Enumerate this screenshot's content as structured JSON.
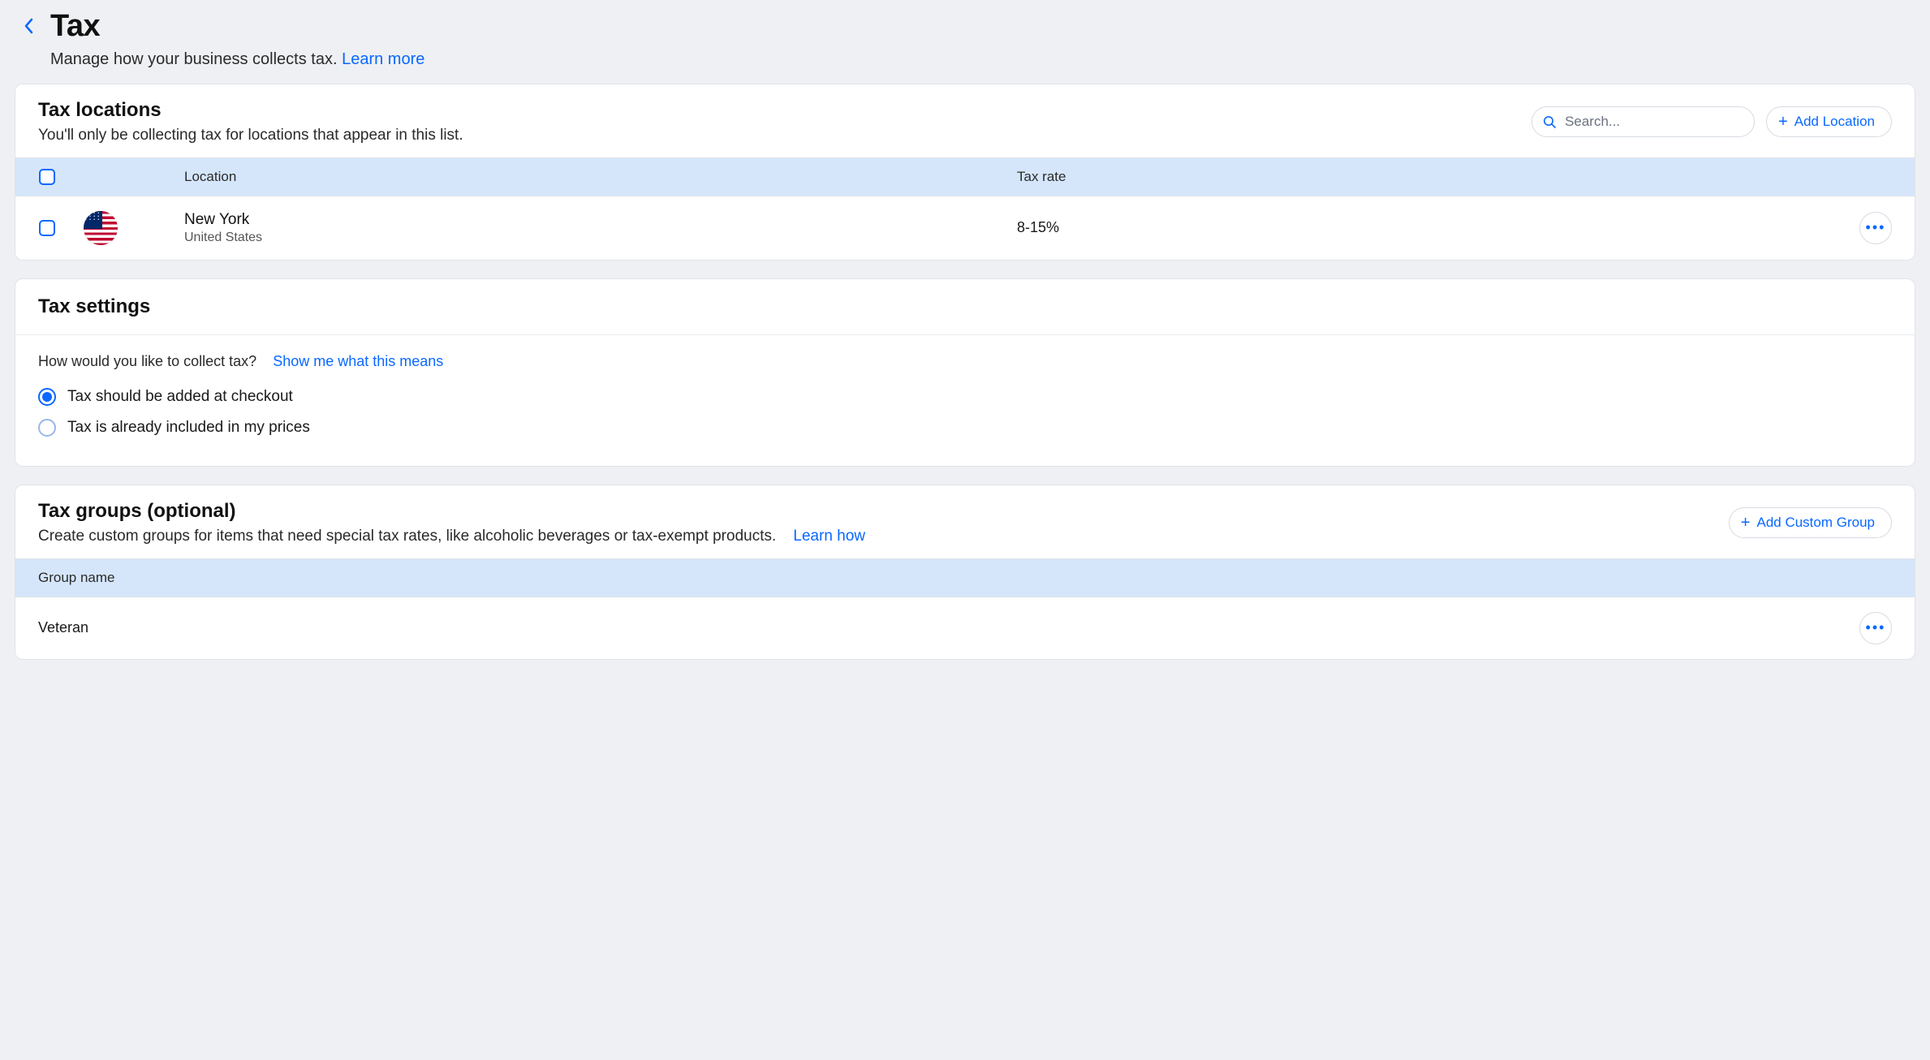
{
  "header": {
    "title": "Tax",
    "subtitle": "Manage how your business collects tax.",
    "learn_more": "Learn more"
  },
  "locations": {
    "title": "Tax locations",
    "subtitle": "You'll only be collecting tax for locations that appear in this list.",
    "search_placeholder": "Search...",
    "add_button": "Add Location",
    "columns": {
      "location": "Location",
      "rate": "Tax rate"
    },
    "rows": [
      {
        "name": "New York",
        "country": "United States",
        "rate": "8-15%"
      }
    ]
  },
  "settings": {
    "title": "Tax settings",
    "question": "How would you like to collect tax?",
    "show_me": "Show me what this means",
    "options": {
      "added": "Tax should be added at checkout",
      "included": "Tax is already included in my prices"
    }
  },
  "groups": {
    "title": "Tax groups (optional)",
    "subtitle": "Create custom groups for items that need special tax rates, like alcoholic beverages or tax-exempt products.",
    "learn_how": "Learn how",
    "add_button": "Add Custom Group",
    "column": "Group name",
    "rows": [
      {
        "name": "Veteran"
      }
    ]
  }
}
